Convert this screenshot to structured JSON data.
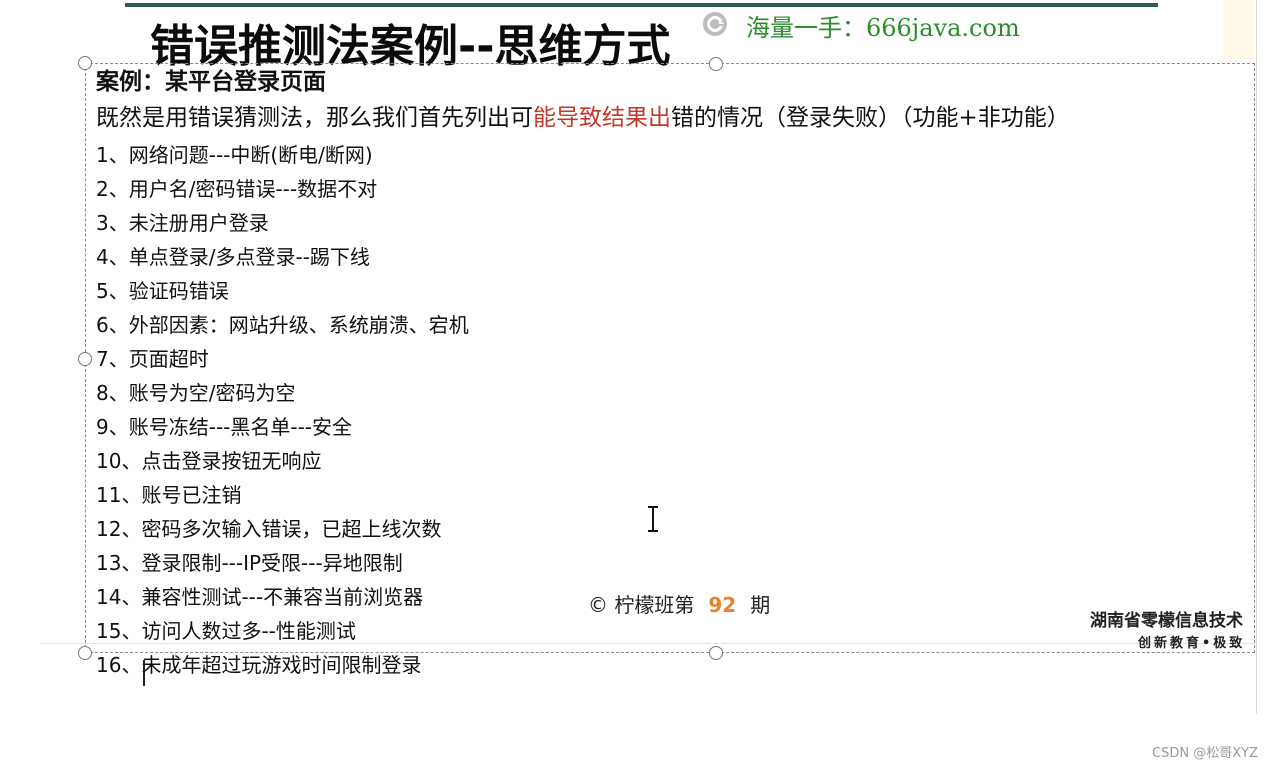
{
  "slide": {
    "title": "错误推测法案例--思维方式",
    "watermark": "海量一手：666java.com",
    "case_title": "案例：某平台登录页面",
    "intro": {
      "part1": "既然是用错误猜测法，那么我们首先列出可",
      "part2_red": "能导致结果出",
      "part3": "错的情况（登录失败）（功能+非功能）"
    },
    "items": [
      "1、网络问题---中断(断电/断网)",
      "2、用户名/密码错误---数据不对",
      "3、未注册用户登录",
      "4、单点登录/多点登录--踢下线",
      "5、验证码错误",
      "6、外部因素：网站升级、系统崩溃、宕机",
      "7、页面超时",
      "8、账号为空/密码为空",
      "9、账号冻结---黑名单---安全",
      "10、点击登录按钮无响应",
      "11、账号已注销",
      "12、密码多次输入错误，已超上线次数",
      "13、登录限制---IP受限---异地限制",
      "14、兼容性测试---不兼容当前浏览器",
      "15、访问人数过多--性能测试",
      "16、未成年超过玩游戏时间限制登录"
    ],
    "footer": {
      "prefix": "© 柠檬班第",
      "number": "92",
      "suffix": "期"
    },
    "logo": {
      "name": "湖南省零檬信息技术",
      "slogan": "创新教育•极致"
    }
  },
  "credit": "CSDN @松哥XYZ",
  "colors": {
    "top_rule": "#2f5b57",
    "watermark": "#2e8b2e",
    "intro_highlight": "#c0392b",
    "footer_number": "#e8822a"
  },
  "icons": [
    "refresh-icon",
    "text-cursor-icon"
  ]
}
